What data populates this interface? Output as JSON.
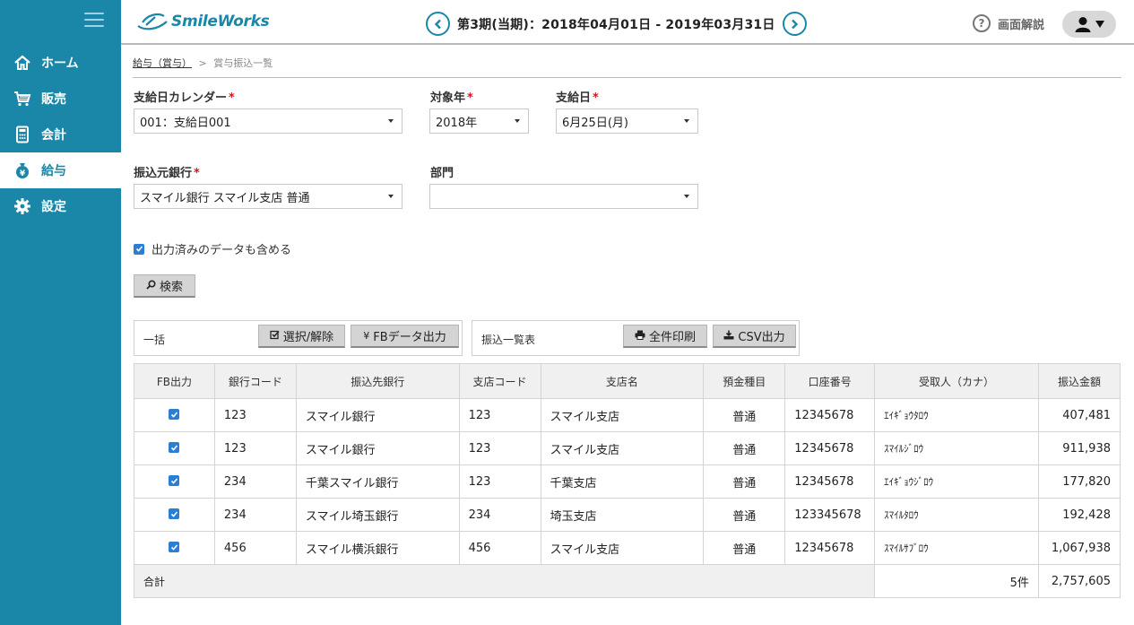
{
  "app": {
    "logo": "SmileWorks",
    "period": "第3期(当期)：2018年04月01日 - 2019年03月31日",
    "help_label": "画面解説"
  },
  "nav": [
    {
      "label": "ホーム",
      "icon": "home-icon"
    },
    {
      "label": "販売",
      "icon": "cart-icon"
    },
    {
      "label": "会計",
      "icon": "calculator-icon"
    },
    {
      "label": "給与",
      "icon": "money-bag-icon",
      "active": true
    },
    {
      "label": "設定",
      "icon": "gear-icon"
    }
  ],
  "breadcrumb": {
    "parent": "給与（賞与）",
    "separator": ">",
    "current": "賞与振込一覧"
  },
  "form": {
    "calendar_label": "支給日カレンダー",
    "calendar_value": "001：支給日001",
    "year_label": "対象年",
    "year_value": "2018年",
    "payday_label": "支給日",
    "payday_value": "6月25日(月)",
    "bank_label": "振込元銀行",
    "bank_value": "スマイル銀行 スマイル支店 普通",
    "dept_label": "部門",
    "dept_value": "",
    "include_output_label": "出力済みのデータも含める",
    "required_mark": "*"
  },
  "buttons": {
    "search": "検索",
    "select_toggle": "選択/解除",
    "fb_output": "FBデータ出力",
    "print_all": "全件印刷",
    "csv_output": "CSV出力"
  },
  "panels": {
    "bulk_label": "一括",
    "list_label": "振込一覧表"
  },
  "table": {
    "headers": [
      "FB出力",
      "銀行コード",
      "振込先銀行",
      "支店コード",
      "支店名",
      "預金種目",
      "口座番号",
      "受取人（カナ）",
      "振込金額"
    ],
    "rows": [
      {
        "bank_code": "123",
        "bank": "スマイル銀行",
        "branch_code": "123",
        "branch": "スマイル支店",
        "type": "普通",
        "account": "12345678",
        "payee": "ｴｲｷﾞｮｳﾀﾛｳ",
        "amount": "407,481"
      },
      {
        "bank_code": "123",
        "bank": "スマイル銀行",
        "branch_code": "123",
        "branch": "スマイル支店",
        "type": "普通",
        "account": "12345678",
        "payee": "ｽﾏｲﾙｼﾞﾛｳ",
        "amount": "911,938"
      },
      {
        "bank_code": "234",
        "bank": "千葉スマイル銀行",
        "branch_code": "123",
        "branch": "千葉支店",
        "type": "普通",
        "account": "12345678",
        "payee": "ｴｲｷﾞｮｳｼﾞﾛｳ",
        "amount": "177,820"
      },
      {
        "bank_code": "234",
        "bank": "スマイル埼玉銀行",
        "branch_code": "234",
        "branch": "埼玉支店",
        "type": "普通",
        "account": "123345678",
        "payee": "ｽﾏｲﾙﾀﾛｳ",
        "amount": "192,428"
      },
      {
        "bank_code": "456",
        "bank": "スマイル横浜銀行",
        "branch_code": "456",
        "branch": "スマイル支店",
        "type": "普通",
        "account": "12345678",
        "payee": "ｽﾏｲﾙｻﾌﾞﾛｳ",
        "amount": "1,067,938"
      }
    ],
    "total_label": "合計",
    "total_count": "5件",
    "total_amount": "2,757,605"
  },
  "colors": {
    "brand": "#1a87a8",
    "required": "#dd1122",
    "checkbox": "#2a7fd4"
  }
}
